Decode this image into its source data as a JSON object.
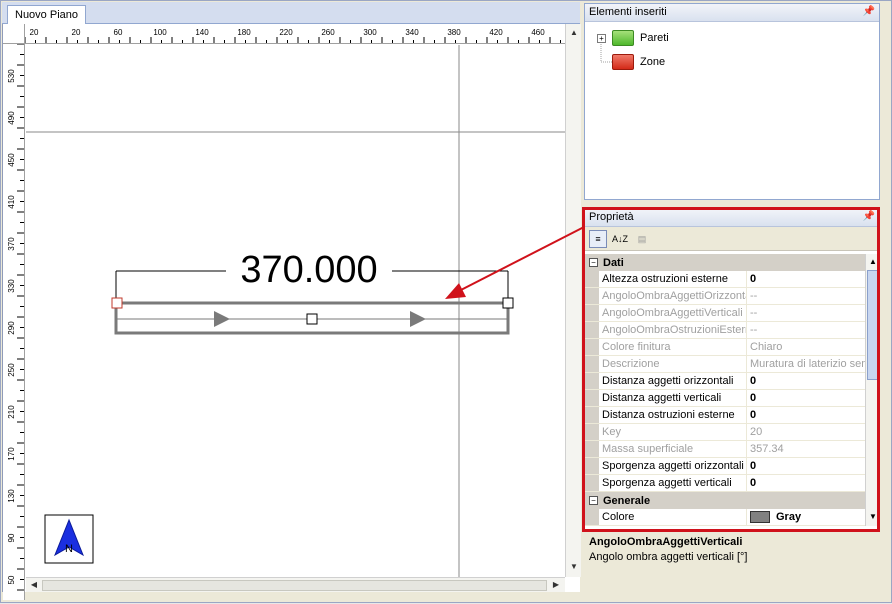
{
  "document_tab": "Nuovo Piano",
  "ruler": {
    "top_labels": [
      "20",
      "20",
      "60",
      "100",
      "140",
      "180",
      "220",
      "260",
      "300",
      "340",
      "380",
      "420",
      "460"
    ],
    "left_labels": [
      "530",
      "490",
      "450",
      "410",
      "370",
      "330",
      "290",
      "250",
      "210",
      "170",
      "130",
      "90",
      "50"
    ]
  },
  "drawing": {
    "dimension_label": "370.000",
    "compass_letter": "N"
  },
  "elements_panel": {
    "title": "Elementi inseriti",
    "items": [
      {
        "label": "Pareti",
        "color": "#4eb82c",
        "expander": "+"
      },
      {
        "label": "Zone",
        "color": "#d32a18",
        "expander": ""
      }
    ]
  },
  "properties_panel": {
    "title": "Proprietà",
    "toolbar": {
      "categorized": "≡",
      "alphabetical": "A↓Z",
      "property_pages": "▤"
    },
    "categories": [
      {
        "name": "Dati",
        "expander": "−",
        "rows": [
          {
            "key": "Altezza ostruzioni esterne",
            "value": "0",
            "dim": false
          },
          {
            "key": "AngoloOmbraAggettiOrizzontali",
            "value": "--",
            "dim": true
          },
          {
            "key": "AngoloOmbraAggettiVerticali",
            "value": "--",
            "dim": true
          },
          {
            "key": "AngoloOmbraOstruzioniEsterne",
            "value": "--",
            "dim": true
          },
          {
            "key": "Colore finitura",
            "value": "Chiaro",
            "dim": true
          },
          {
            "key": "Descrizione",
            "value": "Muratura di laterizio semi",
            "dim": true
          },
          {
            "key": "Distanza aggetti orizzontali",
            "value": "0",
            "dim": false
          },
          {
            "key": "Distanza aggetti verticali",
            "value": "0",
            "dim": false
          },
          {
            "key": "Distanza ostruzioni esterne",
            "value": "0",
            "dim": false
          },
          {
            "key": "Key",
            "value": "20",
            "dim": true
          },
          {
            "key": "Massa superficiale",
            "value": "357.34",
            "dim": true
          },
          {
            "key": "Sporgenza aggetti orizzontali",
            "value": "0",
            "dim": false
          },
          {
            "key": "Sporgenza aggetti verticali",
            "value": "0",
            "dim": false
          }
        ]
      },
      {
        "name": "Generale",
        "expander": "−",
        "rows": [
          {
            "key": "Colore",
            "value": "Gray",
            "dim": false,
            "swatch": "#808080"
          }
        ]
      }
    ]
  },
  "description": {
    "title": "AngoloOmbraAggettiVerticali",
    "text": "Angolo ombra aggetti verticali [°]"
  },
  "colors": {
    "highlight": "#d0121b",
    "arrow": "#d0121b",
    "wall_stroke": "#7a7a7a"
  },
  "icons": [
    "pin-icon",
    "scroll-up-icon",
    "scroll-down-icon",
    "scroll-left-icon",
    "scroll-right-icon",
    "north-arrow-icon",
    "folder-icon"
  ]
}
